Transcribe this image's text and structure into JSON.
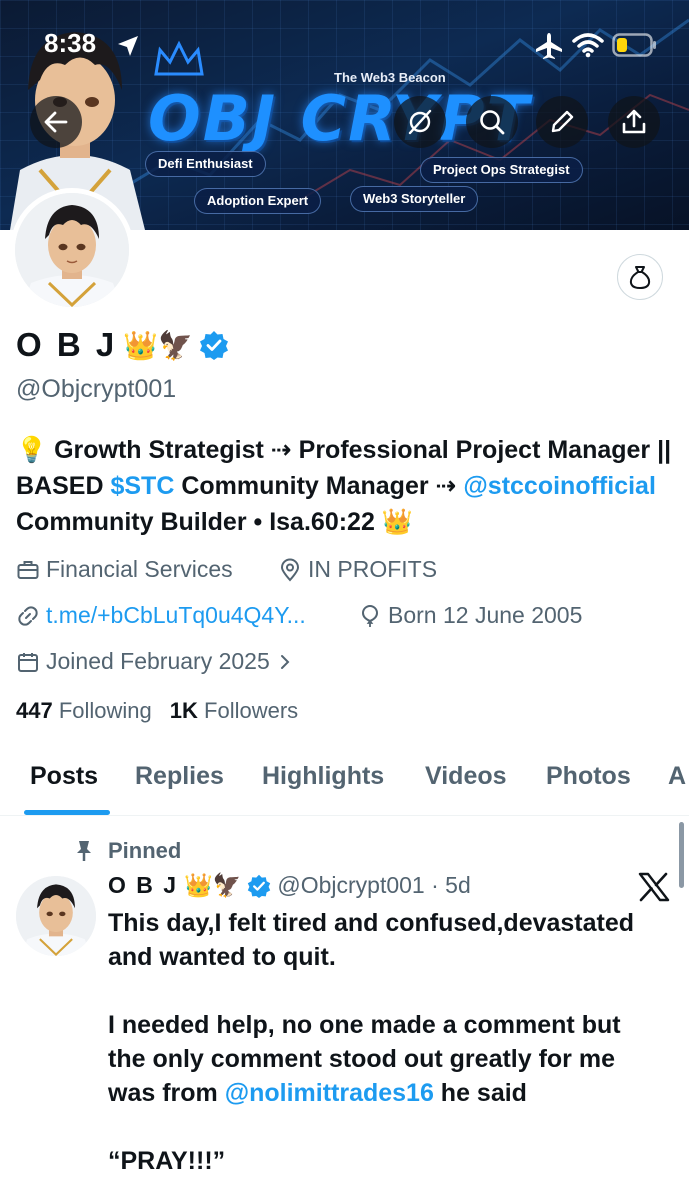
{
  "status_bar": {
    "time": "8:38"
  },
  "banner": {
    "title": "OBJ CRYPT",
    "subtitle": "The Web3 Beacon",
    "tags": [
      "Defi Enthusiast",
      "Project Ops Strategist",
      "Adoption Expert",
      "Web3 Storyteller"
    ]
  },
  "profile": {
    "name": "O B J",
    "name_emojis": "👑🦅",
    "handle": "@Objcrypt001",
    "bio": {
      "part1": "💡 Growth Strategist ⇢ Professional Project Manager || BASED ",
      "cashtag": "$STC",
      "part2": " Community Manager ⇢ ",
      "mention": "@stccoinofficial",
      "part3": " Community Builder • Isa.60:22 👑"
    },
    "category": "Financial Services",
    "location": "IN PROFITS",
    "website": "t.me/+bCbLuTq0u4Q4Y...",
    "birthday": "Born 12 June 2005",
    "joined": "Joined February 2025",
    "following_count": "447",
    "following_label": "Following",
    "followers_count": "1K",
    "followers_label": "Followers"
  },
  "tabs": [
    "Posts",
    "Replies",
    "Highlights",
    "Videos",
    "Photos",
    "A"
  ],
  "active_tab": "Posts",
  "pinned_post": {
    "pinned_label": "Pinned",
    "author_name": "O B J",
    "author_emojis": "👑🦅",
    "meta": "@Objcrypt001 · 5d",
    "para1": "This day,I felt tired and confused,devastated and wanted to quit.",
    "para2_a": "I needed help, no one made a comment but the only comment stood out greatly for me was from ",
    "para2_mention": "@nolimittrades16",
    "para2_b": " he said",
    "para3": "“PRAY!!!”"
  },
  "colors": {
    "accent": "#1d9bf0",
    "text": "#0f1419",
    "secondary": "#536471",
    "banner_title": "#1e90ff"
  },
  "icons": [
    "back-arrow-icon",
    "grok-icon",
    "search-icon",
    "edit-pencil-icon",
    "share-icon",
    "money-bag-icon",
    "verified-badge-icon",
    "briefcase-icon",
    "location-pin-icon",
    "link-icon",
    "balloon-icon",
    "calendar-icon",
    "chevron-right-icon",
    "pin-icon",
    "x-logo-icon"
  ]
}
